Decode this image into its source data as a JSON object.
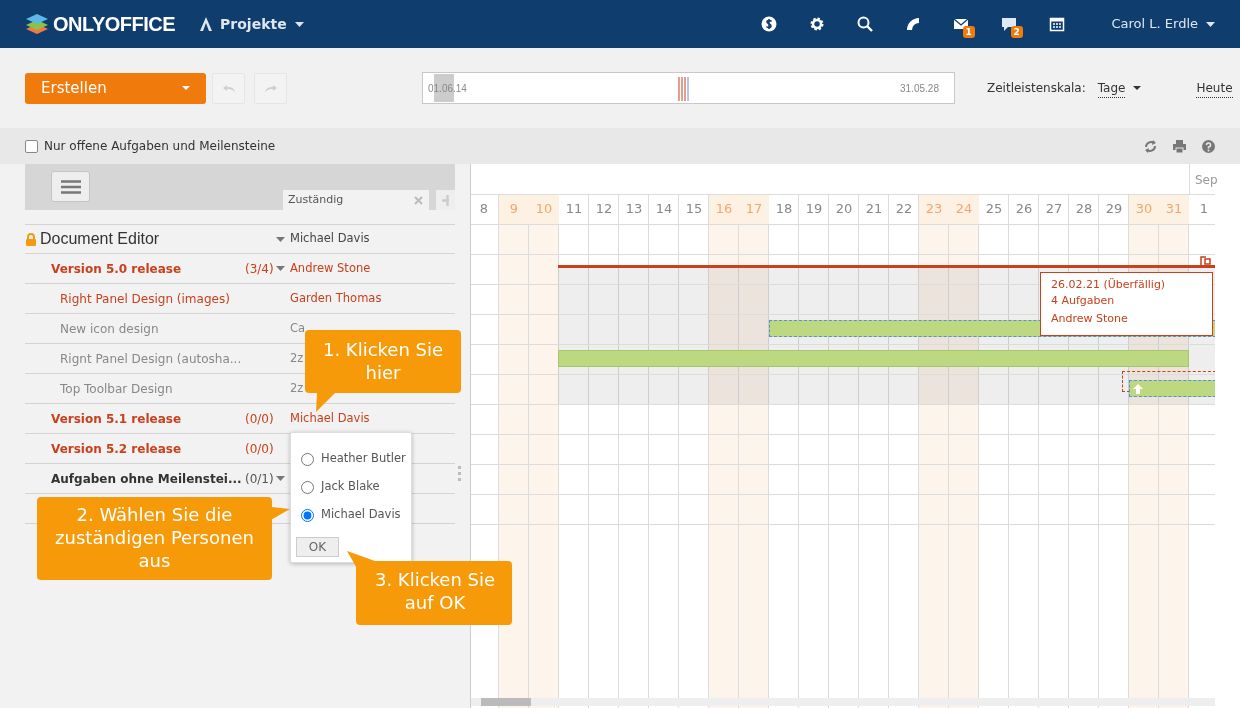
{
  "header": {
    "logo": "ONLYOFFICE",
    "module": "Projekte",
    "mail_badge": "1",
    "chat_badge": "2",
    "user": "Carol L. Erdle"
  },
  "toolbar": {
    "create_button": "Erstellen",
    "history_buttons": [
      {
        "kind": "undo",
        "disabled": true
      },
      {
        "kind": "redo",
        "disabled": true
      }
    ],
    "timeline": {
      "level": 0.02,
      "start": "01.06.14",
      "end": "31.05.28"
    },
    "scale_label": "Zeitleistenskala:",
    "scale_value": "Tage",
    "today_link": "Heute"
  },
  "filter": {
    "label": "Nur offene Aufgaben und Meilensteine",
    "checked": false
  },
  "column_header": {
    "responsible": "Zuständig"
  },
  "rows": [
    {
      "kind": "project",
      "title": "Document Editor",
      "expanded": true,
      "responsible": "Michael Davis",
      "overdue": false
    },
    {
      "kind": "milestone",
      "title": "Version 5.0 release",
      "count": "(3/4)",
      "expanded": true,
      "responsible": "Andrew Stone",
      "overdue": true
    },
    {
      "kind": "task",
      "title": "Right Panel Design (images)",
      "responsible": "Garden Thomas",
      "overdue": true
    },
    {
      "kind": "task",
      "title": "New icon design",
      "responsible": "Ca",
      "overdue": false
    },
    {
      "kind": "task",
      "title": "Rignt Panel Design (autosha...",
      "responsible": "2z",
      "overdue": false
    },
    {
      "kind": "task",
      "title": "Top Toolbar Design",
      "responsible": "2z",
      "overdue": false
    },
    {
      "kind": "milestone",
      "title": "Version 5.1 release",
      "count": "(0/0)",
      "responsible": "Michael Davis",
      "overdue": true
    },
    {
      "kind": "milestone",
      "title": "Version 5.2 release",
      "count": "(0/0)",
      "overdue": true
    },
    {
      "kind": "group",
      "title": "Aufgaben ohne Meilenstei...",
      "count": "(0/1)",
      "expanded": true,
      "overdue": false
    }
  ],
  "assign_popup": {
    "options": [
      {
        "name": "Heather Butler",
        "selected": false
      },
      {
        "name": "Jack Blake",
        "selected": false
      },
      {
        "name": "Michael Davis",
        "selected": true
      }
    ],
    "ok": "OK"
  },
  "gantt": {
    "month": "Sep",
    "days": [
      {
        "label": "8",
        "weekend": false
      },
      {
        "label": "9",
        "weekend": true
      },
      {
        "label": "10",
        "weekend": true
      },
      {
        "label": "11",
        "weekend": false
      },
      {
        "label": "12",
        "weekend": false
      },
      {
        "label": "13",
        "weekend": false
      },
      {
        "label": "14",
        "weekend": false
      },
      {
        "label": "15",
        "weekend": false
      },
      {
        "label": "16",
        "weekend": true
      },
      {
        "label": "17",
        "weekend": true
      },
      {
        "label": "18",
        "weekend": false
      },
      {
        "label": "19",
        "weekend": false
      },
      {
        "label": "20",
        "weekend": false
      },
      {
        "label": "21",
        "weekend": false
      },
      {
        "label": "22",
        "weekend": false
      },
      {
        "label": "23",
        "weekend": true
      },
      {
        "label": "24",
        "weekend": true
      },
      {
        "label": "25",
        "weekend": false
      },
      {
        "label": "26",
        "weekend": false
      },
      {
        "label": "27",
        "weekend": false
      },
      {
        "label": "28",
        "weekend": false
      },
      {
        "label": "29",
        "weekend": false
      },
      {
        "label": "30",
        "weekend": true
      },
      {
        "label": "31",
        "weekend": true
      },
      {
        "label": "1",
        "weekend": false
      }
    ],
    "bars": [
      {
        "kind": "milestone"
      },
      {
        "kind": "task"
      },
      {
        "kind": "task"
      },
      {
        "kind": "subtask"
      }
    ],
    "milestone_tooltip": {
      "date": "26.02.21 (Überfällig)",
      "tasks": "4 Aufgaben",
      "responsible": "Andrew Stone"
    }
  },
  "callouts": [
    "1. Klicken Sie hier",
    "2. Wählen Sie die zuständigen Personen aus",
    "3. Klicken Sie auf OK"
  ]
}
